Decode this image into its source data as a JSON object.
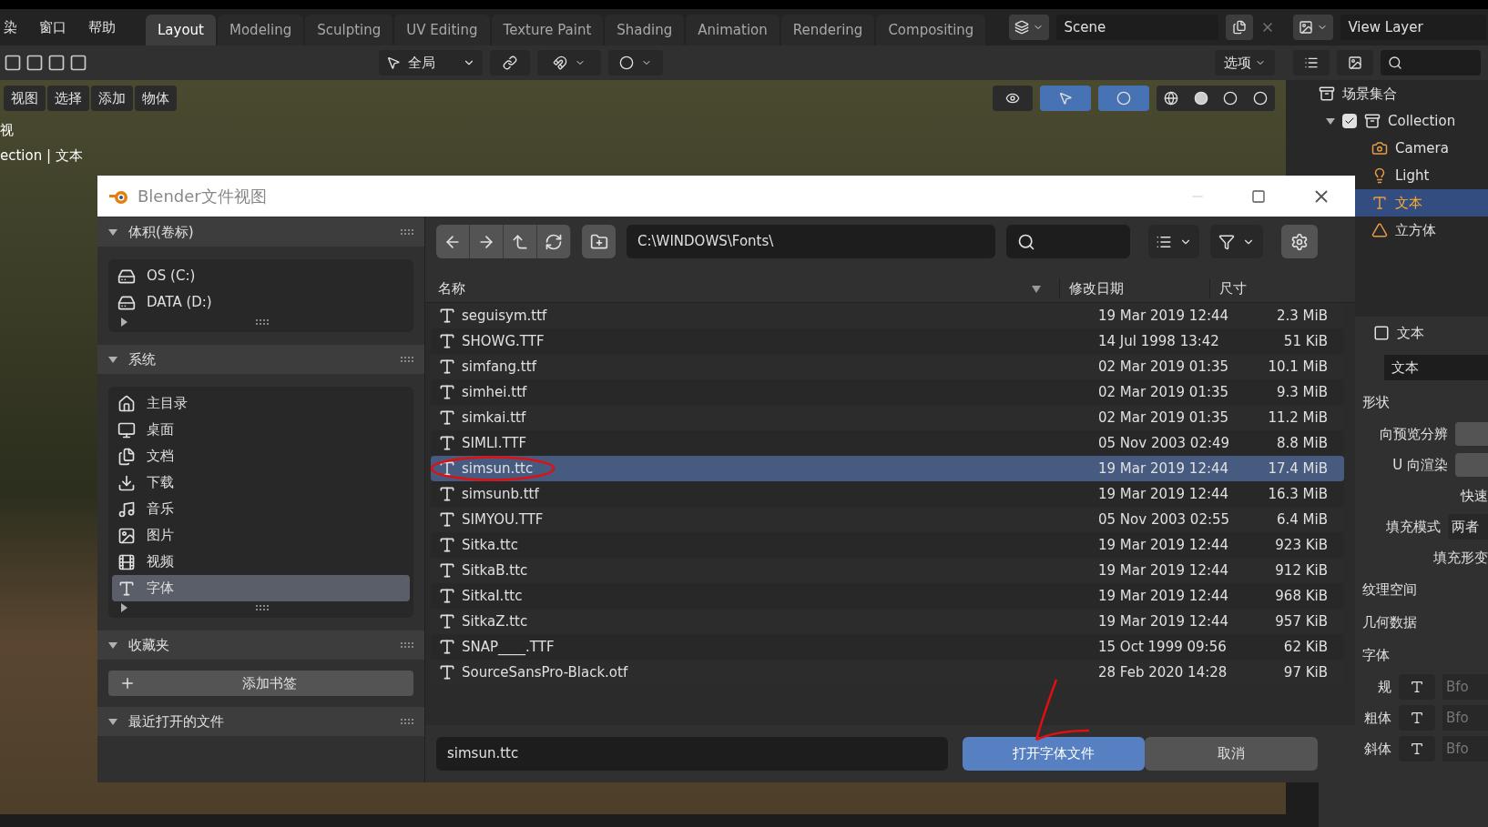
{
  "menu": [
    "染",
    "窗口",
    "帮助"
  ],
  "workspace_tabs": [
    {
      "label": "Layout",
      "selected": true
    },
    {
      "label": "Modeling",
      "selected": false
    },
    {
      "label": "Sculpting",
      "selected": false
    },
    {
      "label": "UV Editing",
      "selected": false
    },
    {
      "label": "Texture Paint",
      "selected": false
    },
    {
      "label": "Shading",
      "selected": false
    },
    {
      "label": "Animation",
      "selected": false
    },
    {
      "label": "Rendering",
      "selected": false
    },
    {
      "label": "Compositing",
      "selected": false
    }
  ],
  "scene": "Scene",
  "view_layer": "View Layer",
  "toolbar": {
    "orientation": "全局",
    "options": "选项"
  },
  "viewport": {
    "menu": [
      "视图",
      "选择",
      "添加",
      "物体"
    ],
    "overlay_text": [
      "视",
      "ection | 文本"
    ]
  },
  "outliner": {
    "root": "场景集合",
    "items": [
      {
        "label": "Collection",
        "kind": "collection",
        "checked": true,
        "expanded": true,
        "selected": false,
        "children": [
          {
            "label": "Camera",
            "kind": "camera",
            "selected": false
          },
          {
            "label": "Light",
            "kind": "light",
            "selected": false
          },
          {
            "label": "文本",
            "kind": "text",
            "selected": true
          },
          {
            "label": "立方体",
            "kind": "mesh",
            "selected": false
          }
        ]
      }
    ]
  },
  "properties": {
    "tab": "文本",
    "data_name": "文本",
    "rows": [
      {
        "kind": "section",
        "label": "形状"
      },
      {
        "kind": "slider",
        "label": "向预览分辨"
      },
      {
        "kind": "slider",
        "label": "U 向渲染"
      },
      {
        "kind": "label",
        "label": "快速"
      },
      {
        "kind": "dropdown",
        "label": "填充模式",
        "value": "两者"
      },
      {
        "kind": "label",
        "label": "填充形变"
      },
      {
        "kind": "section",
        "label": "纹理空间"
      },
      {
        "kind": "section",
        "label": "几何数据"
      },
      {
        "kind": "section",
        "label": "字体"
      },
      {
        "kind": "font",
        "label": "规",
        "value": "Bfo"
      },
      {
        "kind": "font",
        "label": "粗体",
        "value": "Bfo"
      },
      {
        "kind": "font",
        "label": "斜体",
        "value": "Bfo"
      }
    ]
  },
  "dialog": {
    "title": "Blender文件视图",
    "sections": [
      {
        "title": "体积(卷标)",
        "items": [
          {
            "label": "OS (C:)",
            "kind": "drive",
            "selected": false
          },
          {
            "label": "DATA (D:)",
            "kind": "drive",
            "selected": false
          }
        ]
      },
      {
        "title": "系统",
        "items": [
          {
            "label": "主目录",
            "kind": "home",
            "selected": false
          },
          {
            "label": "桌面",
            "kind": "desktop",
            "selected": false
          },
          {
            "label": "文档",
            "kind": "documents",
            "selected": false
          },
          {
            "label": "下载",
            "kind": "download",
            "selected": false
          },
          {
            "label": "音乐",
            "kind": "music",
            "selected": false
          },
          {
            "label": "图片",
            "kind": "pictures",
            "selected": false
          },
          {
            "label": "视频",
            "kind": "video",
            "selected": false
          },
          {
            "label": "字体",
            "kind": "font",
            "selected": true
          }
        ]
      },
      {
        "title": "收藏夹",
        "button": "添加书签"
      },
      {
        "title": "最近打开的文件"
      }
    ],
    "path": "C:\\WINDOWS\\Fonts\\",
    "columns": [
      "名称",
      "修改日期",
      "尺寸"
    ],
    "files": [
      {
        "name": "seguisym.ttf",
        "date": "19 Mar 2019 12:44",
        "size": "2.3 MiB",
        "selected": false
      },
      {
        "name": "SHOWG.TTF",
        "date": "14 Jul 1998 13:42",
        "size": "51 KiB",
        "selected": false
      },
      {
        "name": "simfang.ttf",
        "date": "02 Mar 2019 01:35",
        "size": "10.1 MiB",
        "selected": false
      },
      {
        "name": "simhei.ttf",
        "date": "02 Mar 2019 01:35",
        "size": "9.3 MiB",
        "selected": false
      },
      {
        "name": "simkai.ttf",
        "date": "02 Mar 2019 01:35",
        "size": "11.2 MiB",
        "selected": false
      },
      {
        "name": "SIMLI.TTF",
        "date": "05 Nov 2003 02:49",
        "size": "8.8 MiB",
        "selected": false
      },
      {
        "name": "simsun.ttc",
        "date": "19 Mar 2019 12:44",
        "size": "17.4 MiB",
        "selected": true
      },
      {
        "name": "simsunb.ttf",
        "date": "19 Mar 2019 12:44",
        "size": "16.3 MiB",
        "selected": false
      },
      {
        "name": "SIMYOU.TTF",
        "date": "05 Nov 2003 02:55",
        "size": "6.4 MiB",
        "selected": false
      },
      {
        "name": "Sitka.ttc",
        "date": "19 Mar 2019 12:44",
        "size": "923 KiB",
        "selected": false
      },
      {
        "name": "SitkaB.ttc",
        "date": "19 Mar 2019 12:44",
        "size": "912 KiB",
        "selected": false
      },
      {
        "name": "SitkaI.ttc",
        "date": "19 Mar 2019 12:44",
        "size": "968 KiB",
        "selected": false
      },
      {
        "name": "SitkaZ.ttc",
        "date": "19 Mar 2019 12:44",
        "size": "957 KiB",
        "selected": false
      },
      {
        "name": "SNAP____.TTF",
        "date": "15 Oct 1999 09:56",
        "size": "62 KiB",
        "selected": false
      },
      {
        "name": "SourceSansPro-Black.otf",
        "date": "28 Feb 2020 14:28",
        "size": "97 KiB",
        "selected": false
      }
    ],
    "filename": "simsun.ttc",
    "open_button": "打开字体文件",
    "cancel_button": "取消"
  }
}
